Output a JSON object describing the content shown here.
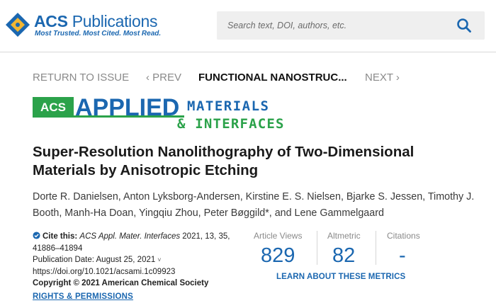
{
  "header": {
    "logo_name_bold": "ACS",
    "logo_name_rest": " Publications",
    "logo_tagline": "Most Trusted. Most Cited. Most Read.",
    "logo_emblem_text": "ACS",
    "search_placeholder": "Search text, DOI, authors, etc.",
    "search_icon": "search-icon"
  },
  "issue_nav": {
    "return_label": "RETURN TO ISSUE",
    "prev_label": "‹ PREV",
    "current_label": "FUNCTIONAL NANOSTRUC...",
    "next_label": "NEXT ›"
  },
  "journal_banner": {
    "acs": "ACS",
    "applied": "APPLIED",
    "materials": "MATERIALS",
    "interfaces": "& INTERFACES",
    "colors": {
      "blue": "#1b67b0",
      "green": "#2ba24a"
    }
  },
  "article": {
    "title": "Super-Resolution Nanolithography of Two-Dimensional Materials by Anisotropic Etching",
    "authors": "Dorte R. Danielsen, Anton Lyksborg-Andersen, Kirstine E. S. Nielsen, Bjarke S. Jessen, Timothy J. Booth, Manh-Ha Doan, Yingqiu Zhou, Peter Bøggild*, and Lene Gammelgaard"
  },
  "citation": {
    "cite_label": "Cite this:",
    "journal": "ACS Appl. Mater. Interfaces",
    "details": " 2021, 13, 35,",
    "pages": "41886–41894",
    "pub_date": "Publication Date: August 25, 2021",
    "chevron": "˅",
    "doi": "https://doi.org/10.1021/acsami.1c09923",
    "copyright": "Copyright © 2021 American Chemical Society",
    "rights": "RIGHTS & PERMISSIONS"
  },
  "metrics": {
    "views_label": "Article Views",
    "views_value": "829",
    "altmetric_label": "Altmetric",
    "altmetric_value": "82",
    "citations_label": "Citations",
    "citations_value": "-",
    "learn_label": "LEARN ABOUT THESE METRICS"
  }
}
